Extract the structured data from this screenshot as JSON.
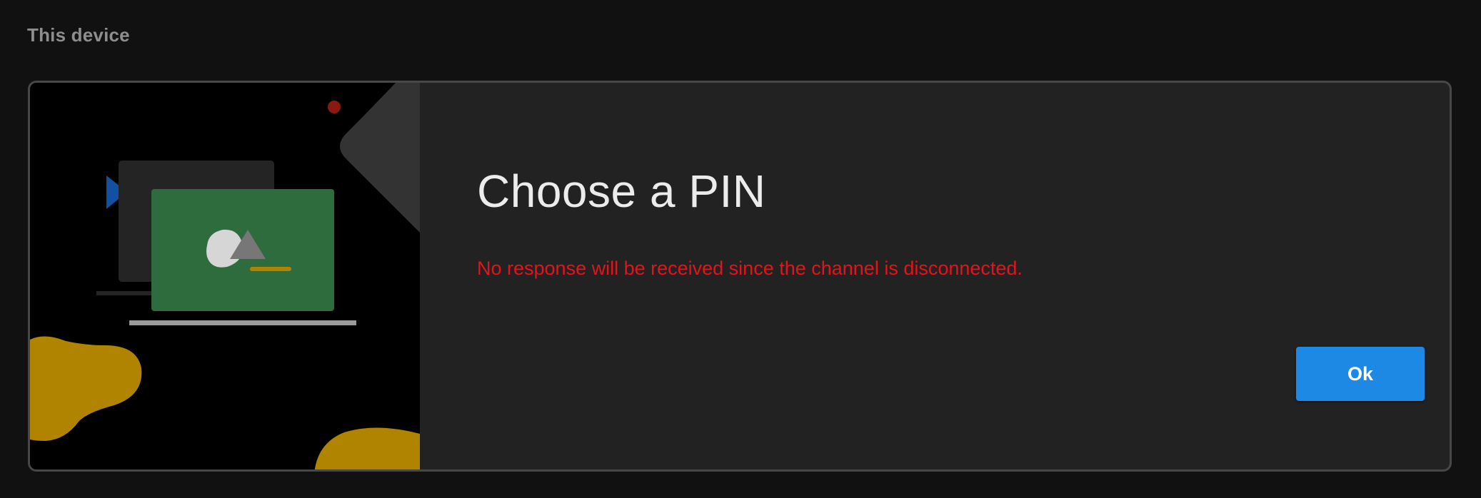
{
  "page": {
    "section_label": "This device"
  },
  "dialog": {
    "title": "Choose a PIN",
    "error_message": "No response will be received since the channel is disconnected.",
    "ok_label": "Ok"
  },
  "colors": {
    "page_background": "#111111",
    "card_background": "#222222",
    "card_border": "#474747",
    "error_text": "#e5141a",
    "button_primary": "#1e88e5",
    "illustration_green": "#2e6b3d",
    "illustration_gold": "#b08400",
    "illustration_blue": "#1450a0",
    "illustration_red": "#8a1a10"
  },
  "icons": {
    "illustration": "computer-screen-with-shapes-illustration"
  }
}
